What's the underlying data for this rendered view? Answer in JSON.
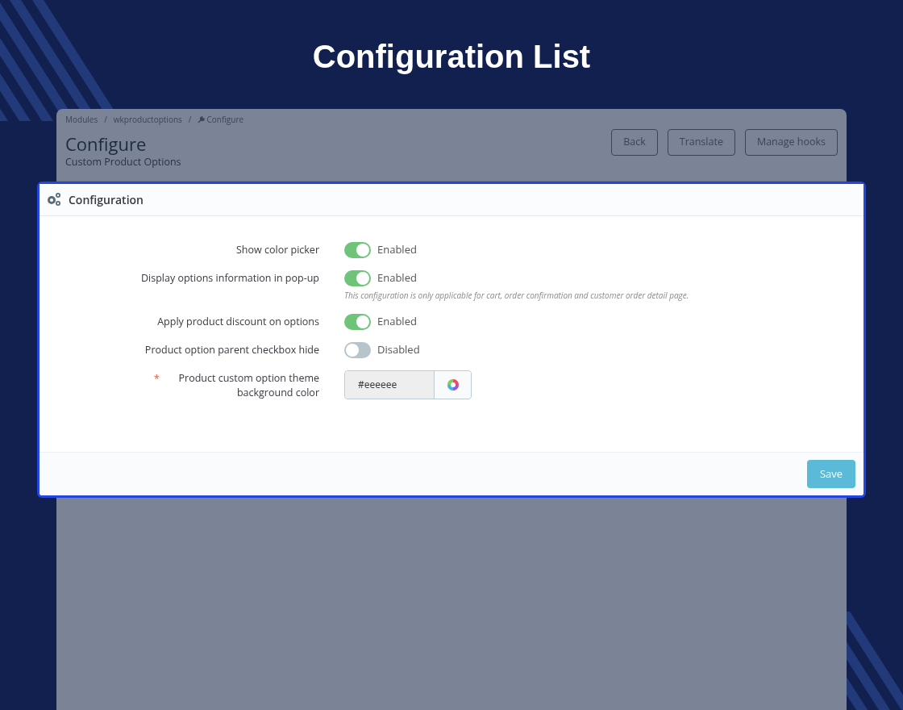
{
  "page_title": "Configuration List",
  "breadcrumb": [
    {
      "kind": "link",
      "text": "Modules"
    },
    {
      "kind": "separator",
      "text": "/"
    },
    {
      "kind": "link",
      "text": "wkproductoptions"
    },
    {
      "kind": "separator",
      "text": "/"
    },
    {
      "kind": "current",
      "text": "Configure"
    }
  ],
  "header": {
    "title": "Configure",
    "subtitle": "Custom Product Options"
  },
  "toolbar_buttons": [
    "Back",
    "Translate",
    "Manage hooks"
  ],
  "panel": {
    "title": "Configuration",
    "settings": [
      {
        "kind": "toggle",
        "label": "Show color picker",
        "on": true,
        "status": "Enabled"
      },
      {
        "kind": "toggle",
        "label": "Display options information in pop-up",
        "on": true,
        "status": "Enabled",
        "help": "This configuration is only applicable for cart, order confirmation and customer order detail page."
      },
      {
        "kind": "toggle",
        "label": "Apply product discount on options",
        "on": true,
        "status": "Enabled"
      },
      {
        "kind": "toggle",
        "label": "Product option parent checkbox hide",
        "on": false,
        "status": "Disabled"
      },
      {
        "kind": "color",
        "label": "Product custom option theme background color",
        "required_mark": "*",
        "value": "#eeeeee"
      }
    ],
    "save_button": "Save"
  }
}
